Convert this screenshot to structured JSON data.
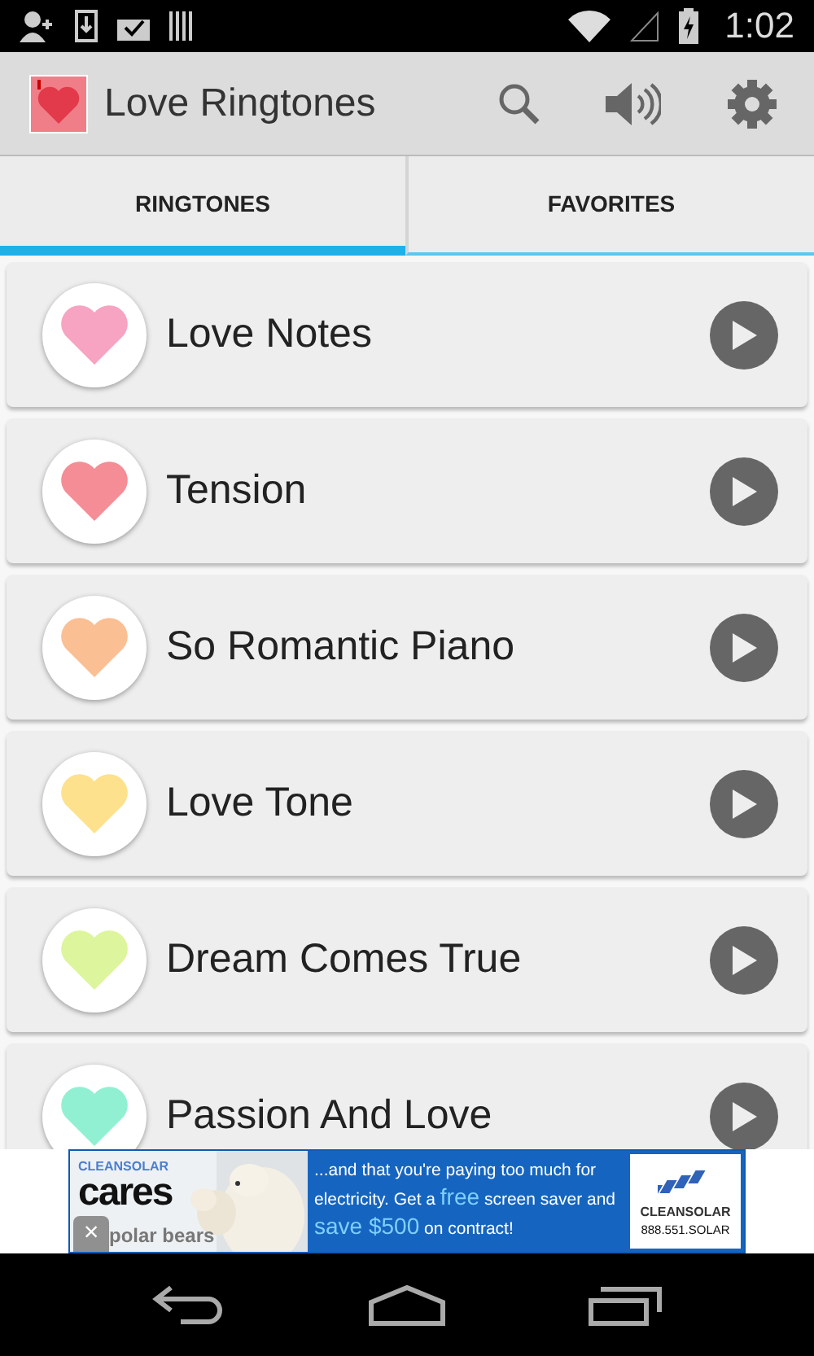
{
  "status_bar": {
    "time": "1:02"
  },
  "app_bar": {
    "title": "Love Ringtones"
  },
  "tabs": [
    {
      "label": "RINGTONES",
      "selected": true
    },
    {
      "label": "FAVORITES",
      "selected": false
    }
  ],
  "ringtones": [
    {
      "name": "Love Notes",
      "color": "#f7a3c2"
    },
    {
      "name": "Tension",
      "color": "#f58d96"
    },
    {
      "name": "So Romantic Piano",
      "color": "#fbbf94"
    },
    {
      "name": "Love Tone",
      "color": "#fde18c"
    },
    {
      "name": "Dream Comes True",
      "color": "#ddf59c"
    },
    {
      "name": "Passion And Love",
      "color": "#92f0d2"
    }
  ],
  "ad": {
    "brand": "CLEANSOLAR",
    "headline": "cares",
    "tagline": "polar bears",
    "message": "...and that you're paying too much for electricity. Get a **free** screen saver and **save $500** on contract!",
    "logo_text": "CLEANSOLAR",
    "phone": "888.551.SOLAR",
    "close": "×"
  }
}
